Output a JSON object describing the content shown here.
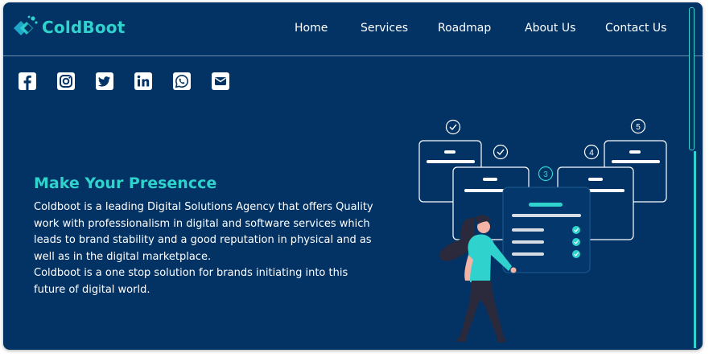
{
  "brand": {
    "name": "ColdBoot",
    "accent": "#2fd2cd",
    "background": "#033364"
  },
  "nav": {
    "items": [
      {
        "label": "Home"
      },
      {
        "label": "Services"
      },
      {
        "label": "Roadmap"
      },
      {
        "label": "About Us"
      },
      {
        "label": "Contact Us"
      }
    ]
  },
  "social": [
    "facebook-icon",
    "instagram-icon",
    "twitter-icon",
    "linkedin-icon",
    "whatsapp-icon",
    "email-icon"
  ],
  "hero": {
    "title": "Make Your Presencce",
    "paragraph1": "Coldboot is a leading Digital Solutions Agency that offers Quality work with professionalism in digital and software services which leads to brand stability and a good reputation in physical and as well as in the digital marketplace.",
    "paragraph2": "Coldboot is a one stop solution for brands initiating into this future of digital world."
  },
  "illustration": {
    "steps": [
      "3",
      "4",
      "5"
    ]
  }
}
